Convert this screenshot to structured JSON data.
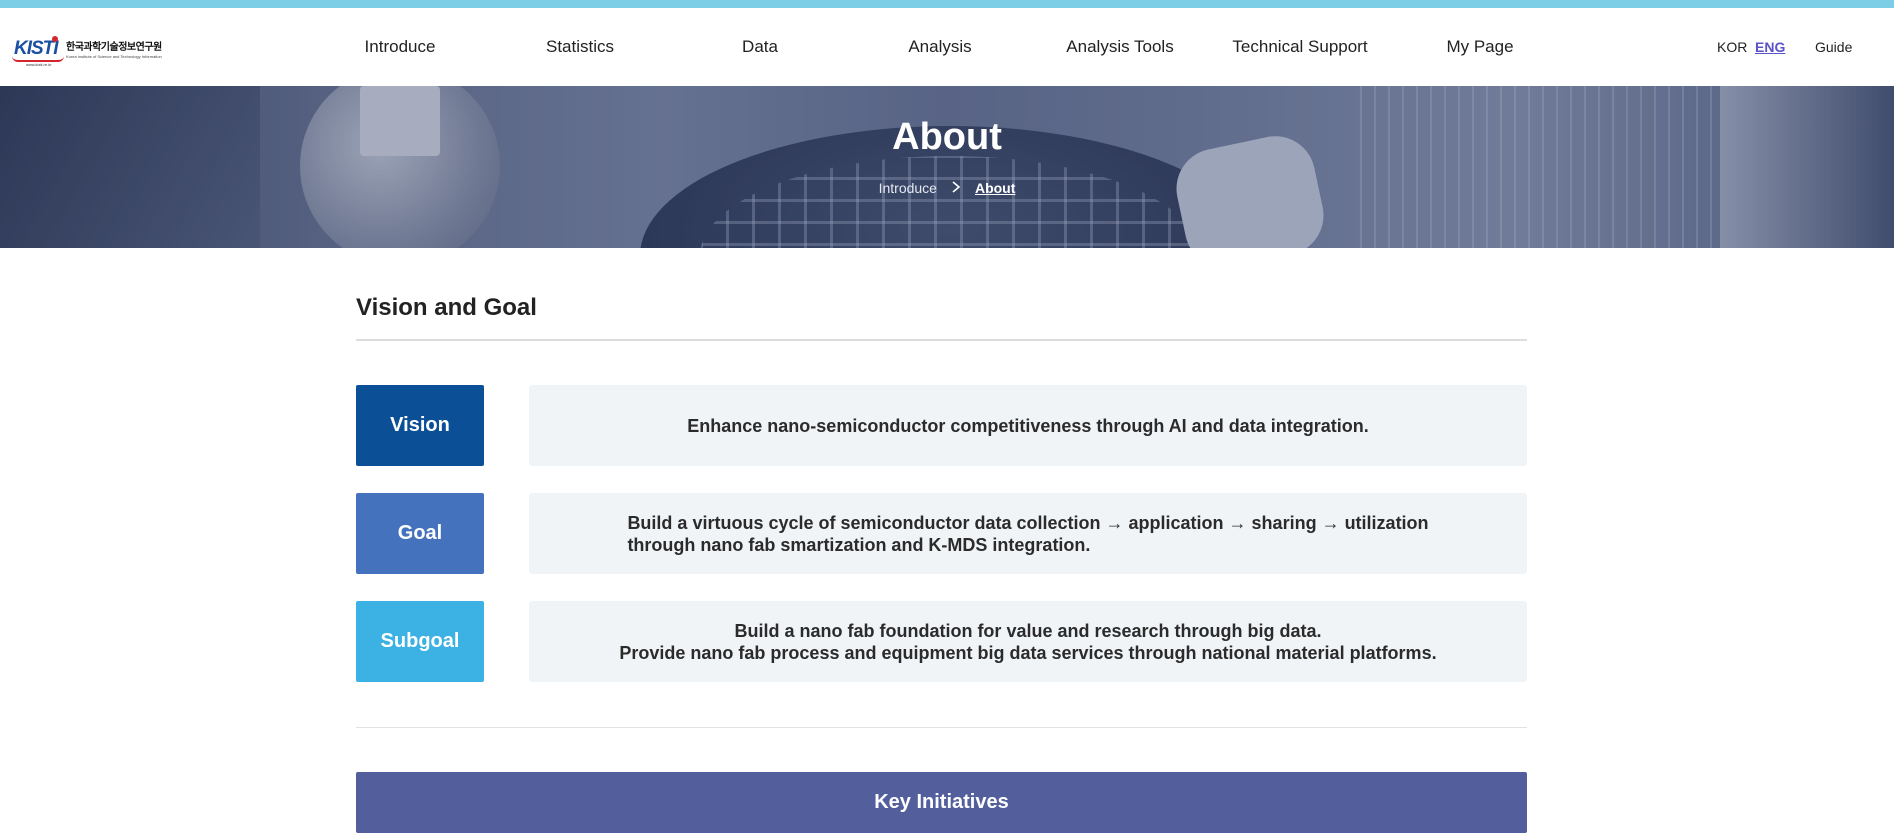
{
  "header": {
    "logo": {
      "mark_text": "KISTI",
      "korean_name": "한국과학기술정보연구원",
      "english_name": "Korea Institute of Science and Technology Information",
      "url": "www.kisti.re.kr"
    },
    "nav": [
      "Introduce",
      "Statistics",
      "Data",
      "Analysis",
      "Analysis Tools",
      "Technical Support",
      "My Page"
    ],
    "lang": {
      "kor": "KOR",
      "eng": "ENG",
      "active": "ENG"
    },
    "guide": "Guide"
  },
  "hero": {
    "title": "About",
    "breadcrumb": [
      "Introduce",
      "About"
    ]
  },
  "section": {
    "title": "Vision and Goal",
    "rows": [
      {
        "label": "Vision",
        "color": "#0b4f96",
        "lines": [
          "Enhance nano-semiconductor competitiveness through AI and data integration."
        ]
      },
      {
        "label": "Goal",
        "color": "#4472bd",
        "lines": [
          "Build a virtuous cycle of semiconductor data collection → application → sharing → utilization",
          "through nano fab smartization and K-MDS integration."
        ]
      },
      {
        "label": "Subgoal",
        "color": "#3cb1e3",
        "lines": [
          "Build a nano fab foundation for value and research through big data.",
          "Provide nano fab process and equipment big data services through national material platforms."
        ]
      }
    ]
  },
  "key_initiatives": {
    "label": "Key Initiatives",
    "color": "#525f9c"
  },
  "colors": {
    "topbar": "#7ccde6",
    "accent": "#5a52c8"
  }
}
